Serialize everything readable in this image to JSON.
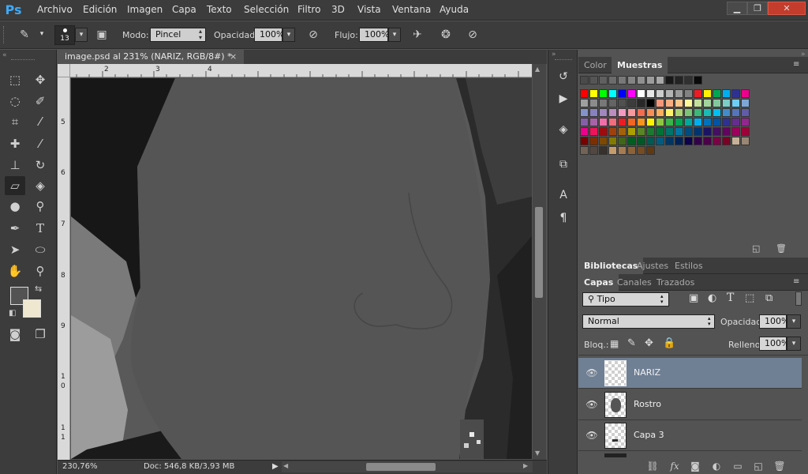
{
  "app": {
    "logo": "Ps"
  },
  "menu": [
    "Archivo",
    "Edición",
    "Imagen",
    "Capa",
    "Texto",
    "Selección",
    "Filtro",
    "3D",
    "Vista",
    "Ventana",
    "Ayuda"
  ],
  "window_buttons": {
    "minimize": "▁",
    "restore": "❐",
    "close": "✕"
  },
  "options": {
    "brush_size": "13",
    "mode_label": "Modo:",
    "mode_value": "Pincel",
    "opacity_label": "Opacidad:",
    "opacity_value": "100%",
    "flow_label": "Flujo:",
    "flow_value": "100%"
  },
  "document": {
    "tab_title": "image.psd al 231% (NARIZ, RGB/8#) *",
    "close": "×",
    "zoom": "230,76%",
    "doc_info": "Doc: 546,8 KB/3,93 MB",
    "ruler_top": [
      "2",
      "3",
      "4"
    ],
    "ruler_left": [
      "5",
      "6",
      "7",
      "8",
      "9",
      "1",
      "0",
      "1",
      "1"
    ]
  },
  "panels": {
    "top_tabs": [
      "Color",
      "Muestras"
    ],
    "mid_tabs": [
      "Bibliotecas",
      "Ajustes",
      "Estilos"
    ],
    "layer_tabs": [
      "Capas",
      "Canales",
      "Trazados"
    ],
    "layers_filter": "Tipo",
    "blend_mode": "Normal",
    "opacity_label": "Opacidad:",
    "opacity_value": "100%",
    "lock_label": "Bloq.:",
    "fill_label": "Relleno:",
    "fill_value": "100%"
  },
  "swatches": {
    "row0": [
      "#4a4a4a",
      "#555555",
      "#606060",
      "#6c6c6c",
      "#787878",
      "#848484",
      "#909090",
      "#9c9c9c",
      "#a8a8a8",
      "#181818",
      "#242424",
      "#303030",
      "#0a0a0a"
    ],
    "row1": [
      "#ff0000",
      "#ffff00",
      "#00ff00",
      "#00ffff",
      "#0000ff",
      "#ff00ff",
      "#ffffff",
      "#e6e6e6",
      "#cdcdcd",
      "#b4b4b4",
      "#9b9b9b",
      "#828282",
      "#ed1c24",
      "#fff200",
      "#00a651",
      "#00aeef",
      "#2e3192",
      "#ec008c"
    ],
    "row2": [
      "#a0a0a0",
      "#8c8c8c",
      "#787878",
      "#646464",
      "#505050",
      "#3c3c3c",
      "#282828",
      "#000000",
      "#f7977a",
      "#f9ad81",
      "#fdc68a",
      "#fff79a",
      "#c4df9b",
      "#a3d39c",
      "#82ca9d",
      "#7bcdc8",
      "#6ecff6",
      "#7ea7d8"
    ],
    "row3": [
      "#8493ca",
      "#8882be",
      "#a187be",
      "#bc8dbf",
      "#f49ac2",
      "#f6989d",
      "#f26c4f",
      "#f68e55",
      "#fbaf5c",
      "#fff467",
      "#acd372",
      "#7cc576",
      "#3bb878",
      "#1abbb4",
      "#00bff3",
      "#438ccb",
      "#5574b9",
      "#605ca8"
    ],
    "row4": [
      "#855fa8",
      "#a763a8",
      "#f06ea9",
      "#f26d7d",
      "#ed1c24",
      "#f26522",
      "#f7941d",
      "#fff200",
      "#8dc73f",
      "#39b54a",
      "#00a651",
      "#00a99d",
      "#00aeef",
      "#0072bc",
      "#0054a6",
      "#2e3192",
      "#662d91",
      "#92278f"
    ],
    "row5": [
      "#ec008c",
      "#ed145b",
      "#9e0b0f",
      "#a0410d",
      "#a36209",
      "#aba000",
      "#598527",
      "#1a7b30",
      "#007236",
      "#00746b",
      "#0076a3",
      "#004b80",
      "#003471",
      "#1b1464",
      "#440e62",
      "#630460",
      "#9e005d",
      "#9e0039"
    ],
    "row6": [
      "#790000",
      "#7b2e00",
      "#7d4900",
      "#827b00",
      "#406618",
      "#005e20",
      "#005826",
      "#005952",
      "#005b7f",
      "#003663",
      "#002157",
      "#0d004c",
      "#32004b",
      "#4b0049",
      "#7b0046",
      "#7a0026",
      "#c7b299",
      "#998675"
    ],
    "row7": [
      "#736357",
      "#534741",
      "#37302d",
      "#c69c6d",
      "#a67c52",
      "#8c6239",
      "#754c24",
      "#603913"
    ]
  },
  "layers": [
    {
      "name": "NARIZ",
      "selected": true
    },
    {
      "name": "Rostro",
      "selected": false
    },
    {
      "name": "Capa 3",
      "selected": false
    }
  ]
}
